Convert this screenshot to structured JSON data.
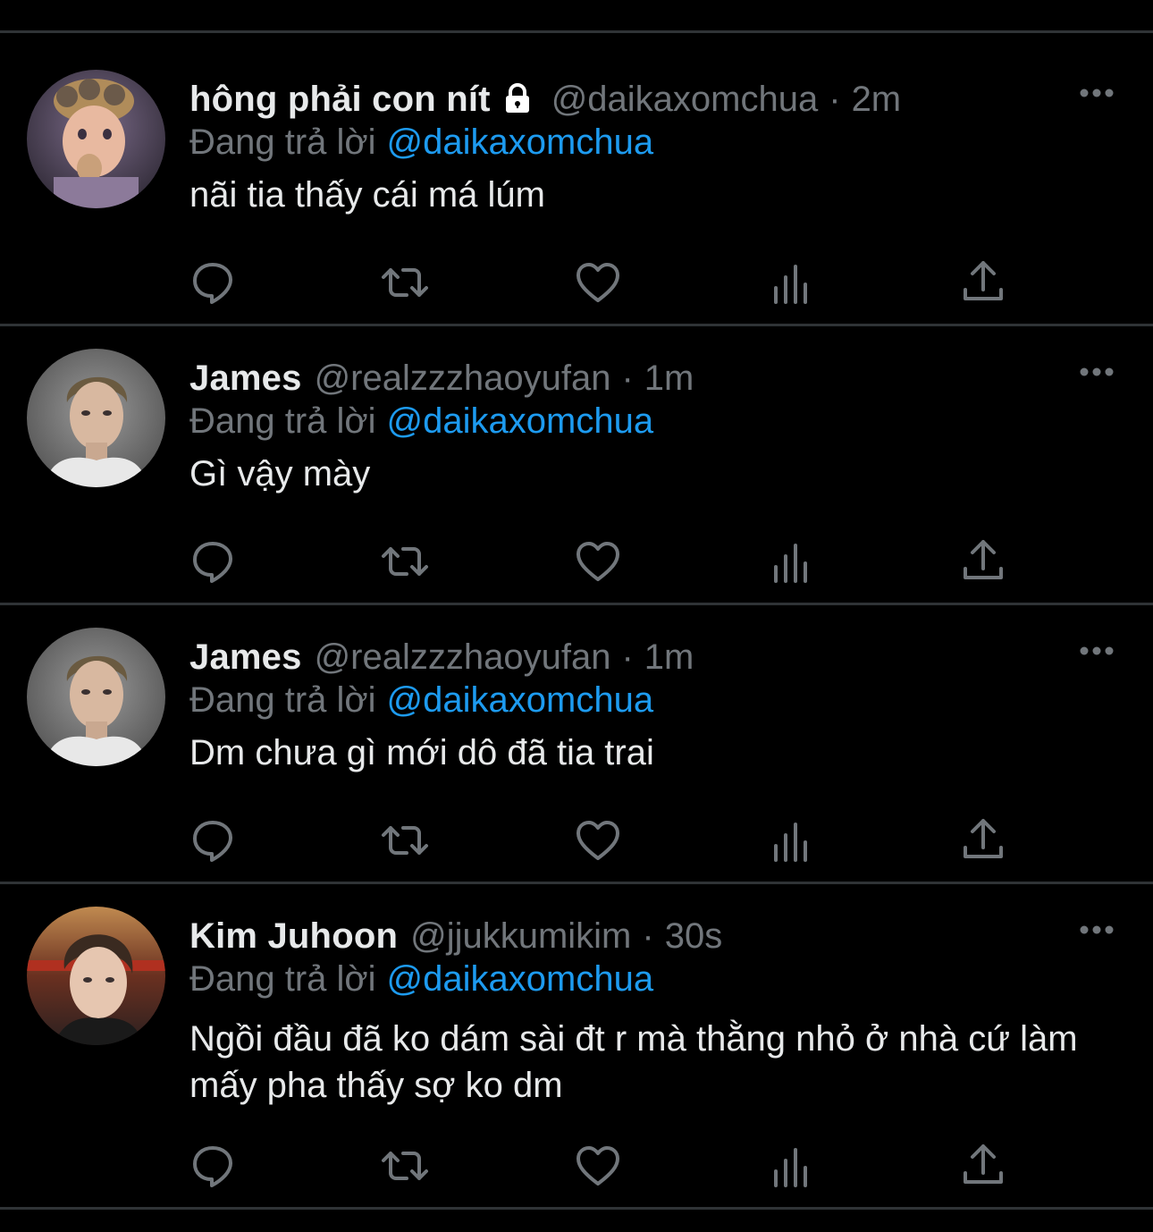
{
  "reply_prefix": "Đang trả lời",
  "tweets": [
    {
      "display_name": "hông phải con nít",
      "protected": true,
      "handle": "@daikaxomchua",
      "separator": "·",
      "time": "2m",
      "reply_to": "@daikaxomchua",
      "text": "nãi tia thấy cái má lúm"
    },
    {
      "display_name": "James",
      "protected": false,
      "handle": "@realzzzhaoyufan",
      "separator": "·",
      "time": "1m",
      "reply_to": "@daikaxomchua",
      "text": "Gì vậy mày"
    },
    {
      "display_name": "James",
      "protected": false,
      "handle": "@realzzzhaoyufan",
      "separator": "·",
      "time": "1m",
      "reply_to": "@daikaxomchua",
      "text": "Dm chưa gì mới dô đã tia trai"
    },
    {
      "display_name": "Kim Juhoon",
      "protected": false,
      "handle": "@jjukkumikim",
      "separator": "·",
      "time": "30s",
      "reply_to": "@daikaxomchua",
      "text": "Ngồi đầu đã ko dám sài đt r mà thằng nhỏ ở nhà cứ làm mấy pha thấy sợ ko dm"
    }
  ],
  "icons": {
    "reply": "reply-icon",
    "retweet": "retweet-icon",
    "like": "heart-icon",
    "analytics": "analytics-icon",
    "share": "share-icon",
    "more": "more-icon",
    "lock": "lock-icon"
  },
  "colors": {
    "background": "#000000",
    "text": "#e7e9ea",
    "secondary": "#71767b",
    "link": "#1d9bf0",
    "divider": "#2f3336"
  }
}
